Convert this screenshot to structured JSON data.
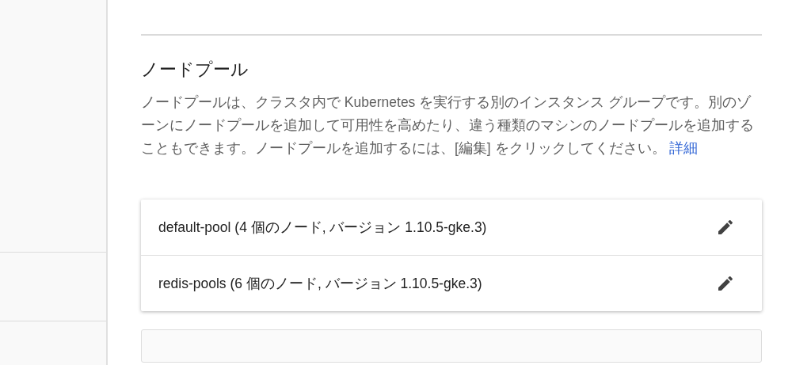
{
  "section": {
    "title": "ノードプール",
    "description": "ノードプールは、クラスタ内で Kubernetes を実行する別のインスタンス グループです。別のゾーンにノードプールを追加して可用性を高めたり、違う種類のマシンのノードプールを追加することもできます。ノードプールを追加するには、[編集] をクリックしてください。",
    "link": "詳細"
  },
  "node_pools": [
    {
      "label": "default-pool (4 個のノード, バージョン 1.10.5-gke.3)"
    },
    {
      "label": "redis-pools (6 個のノード, バージョン 1.10.5-gke.3)"
    }
  ]
}
